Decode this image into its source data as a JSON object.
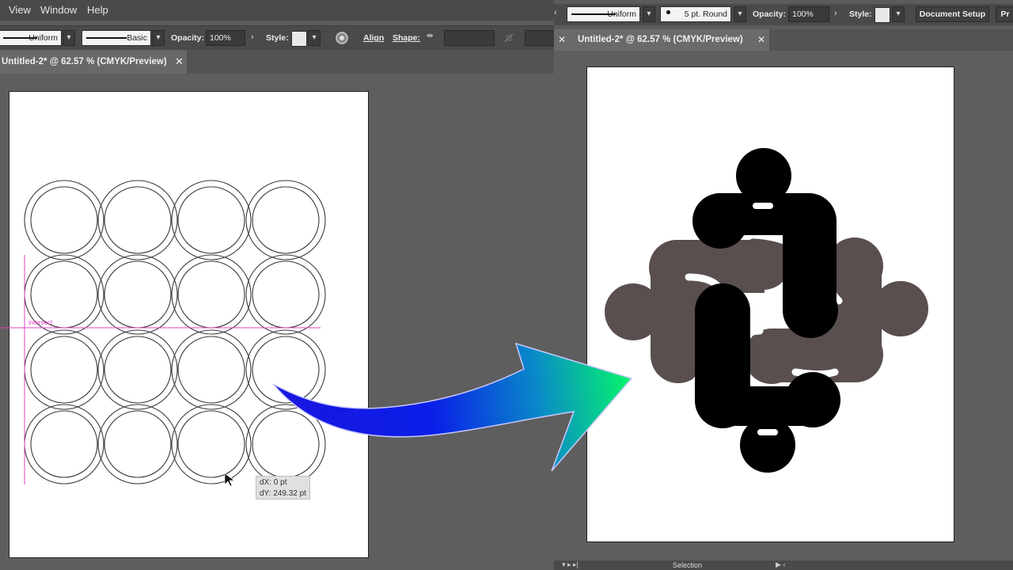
{
  "left_menu": {
    "items": [
      "View",
      "Window",
      "Help"
    ]
  },
  "left_control": {
    "stroke_profile": "Uniform",
    "brush": "Basic",
    "opacity_label": "Opacity:",
    "opacity_value": "100%",
    "style_label": "Style:",
    "align_label": "Align",
    "shape_label": "Shape:"
  },
  "left_tab": {
    "title": "Untitled-2* @ 62.57 % (CMYK/Preview)",
    "close": "✕"
  },
  "guide_label": "intersect",
  "tooltip": {
    "dx": "dX: 0 pt",
    "dy": "dY: 249.32 pt"
  },
  "right_control": {
    "stroke_profile": "Uniform",
    "brush": "5 pt. Round",
    "opacity_label": "Opacity:",
    "opacity_value": "100%",
    "style_label": "Style:",
    "document_setup": "Document Setup",
    "preferences_fragment": "Pr"
  },
  "right_tab": {
    "title": "Untitled-2* @ 62.57 % (CMYK/Preview)",
    "close": "✕",
    "left_x": "✕"
  },
  "status": {
    "tool": "Selection"
  },
  "colors": {
    "logo_dark": "#000000",
    "logo_gray": "#594f4f",
    "arrow_start": "#1a14e0",
    "arrow_end": "#05f070",
    "guide": "#e040c0"
  }
}
